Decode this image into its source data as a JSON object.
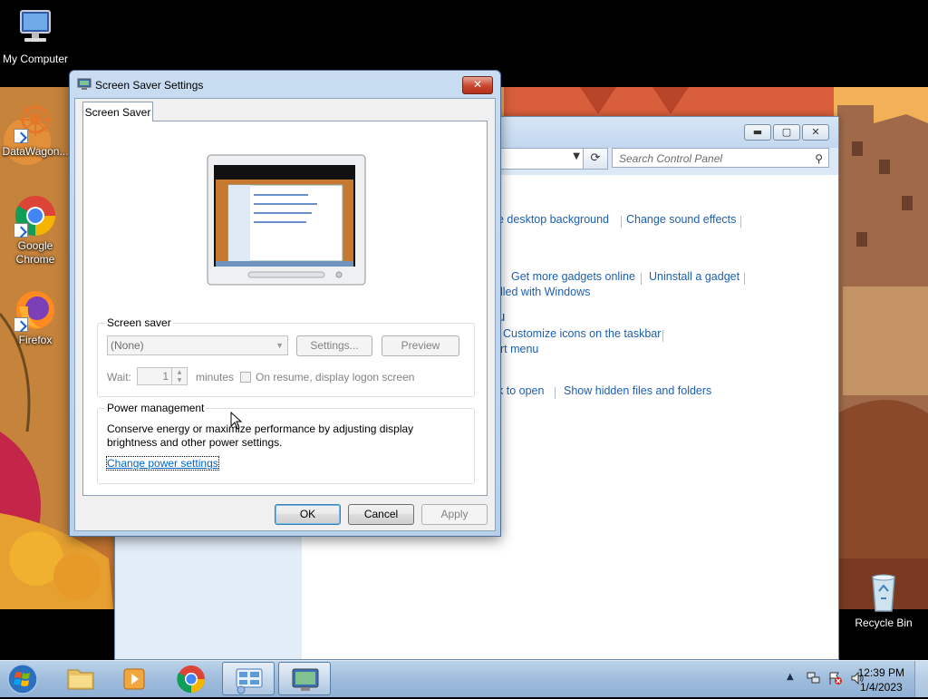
{
  "desktop": {
    "icons": [
      {
        "label": "My Computer"
      },
      {
        "label": "DataWagon..."
      },
      {
        "label": "Google Chrome"
      },
      {
        "label": "Firefox"
      },
      {
        "label": "Recycle Bin"
      }
    ]
  },
  "control_panel": {
    "search_placeholder": "Search Control Panel",
    "links": [
      "e desktop background",
      "Change sound effects",
      "Get more gadgets online",
      "Uninstall a gadget",
      "lled with Windows",
      "u",
      "Customize icons on the taskbar",
      "rt menu",
      "k to open",
      "Show hidden files and folders"
    ]
  },
  "dialog": {
    "title": "Screen Saver Settings",
    "close_label": "✕",
    "tab_label": "Screen Saver",
    "screen_saver_group": {
      "legend": "Screen saver",
      "selected": "(None)",
      "settings_label": "Settings...",
      "preview_label": "Preview",
      "wait_label": "Wait:",
      "wait_value": "1",
      "minutes_label": "minutes",
      "resume_label": "On resume, display logon screen"
    },
    "power_group": {
      "legend": "Power management",
      "description_1": "Conserve energy or maximize performance by adjusting display",
      "description_2": "brightness and other power settings.",
      "link": "Change power settings"
    },
    "buttons": {
      "ok": "OK",
      "cancel": "Cancel",
      "apply": "Apply"
    }
  },
  "taskbar": {
    "time": "12:39 PM",
    "date": "1/4/2023"
  },
  "colors": {
    "link": "#1e5fb0",
    "accent": "#3c7fb1"
  }
}
